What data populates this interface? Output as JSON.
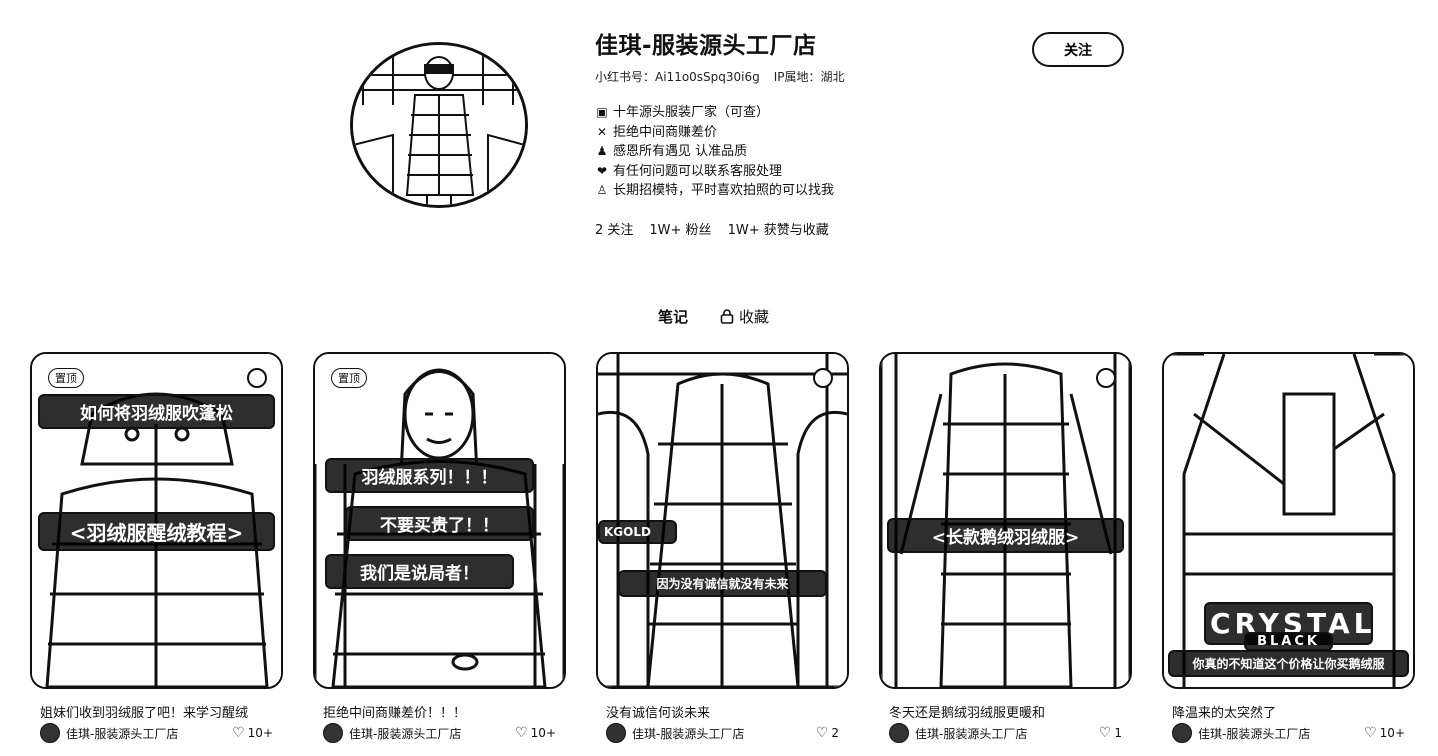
{
  "profile": {
    "name": "佳琪-服装源头工厂店",
    "red_id_label": "小红书号：",
    "red_id": "Ai11o0sSpq30i6g",
    "ip_label": "IP属地：",
    "ip_region": "湖北",
    "bio": [
      {
        "icon": "factory-icon",
        "glyph": "▣",
        "text": "十年源头服装厂家（可查）"
      },
      {
        "icon": "cross-icon",
        "glyph": "✕",
        "text": "拒绝中间商赚差价"
      },
      {
        "icon": "person-icon",
        "glyph": "♟",
        "text": "感恩所有遇见 认准品质"
      },
      {
        "icon": "heart-chat-icon",
        "glyph": "❤",
        "text": "有任何问题可以联系客服处理"
      },
      {
        "icon": "camera-person-icon",
        "glyph": "♙",
        "text": "长期招模特，平时喜欢拍照的可以找我"
      }
    ],
    "stats": {
      "following": "2 关注",
      "followers": "1W+ 粉丝",
      "likes": "1W+ 获赞与收藏"
    },
    "follow_label": "关注"
  },
  "tabs": {
    "notes": "笔记",
    "collections": "收藏"
  },
  "cards": [
    {
      "pinned": "置顶",
      "overlay_top": "如何将羽绒服吹蓬松",
      "overlay_mid": "<羽绒服醒绒教程>",
      "title": "姐妹们收到羽绒服了吧！来学习醒绒啦！",
      "author": "佳琪-服装源头工厂店",
      "likes": "10+"
    },
    {
      "pinned": "置顶",
      "overlay_1": "羽绒服系列！！！",
      "overlay_2": "不要买贵了！！",
      "overlay_3": "我们是说局者！",
      "title": "拒绝中间商赚差价！！！",
      "author": "佳琪-服装源头工厂店",
      "likes": "10+"
    },
    {
      "overlay_brand": "KGOLD",
      "overlay_caption": "因为没有诚信就没有未来",
      "title": "没有诚信何谈未来",
      "author": "佳琪-服装源头工厂店",
      "likes": "2"
    },
    {
      "overlay_mid": "<长款鹅绒羽绒服>",
      "title": "冬天还是鹅绒羽绒服更暖和",
      "author": "佳琪-服装源头工厂店",
      "likes": "1"
    },
    {
      "overlay_brand_a": "CRYSTAL",
      "overlay_brand_b": "BLACK",
      "overlay_caption": "你真的不知道这个价格让你买鹅绒服",
      "title": "降温来的太突然了",
      "author": "佳琪-服装源头工厂店",
      "likes": "10+"
    }
  ]
}
